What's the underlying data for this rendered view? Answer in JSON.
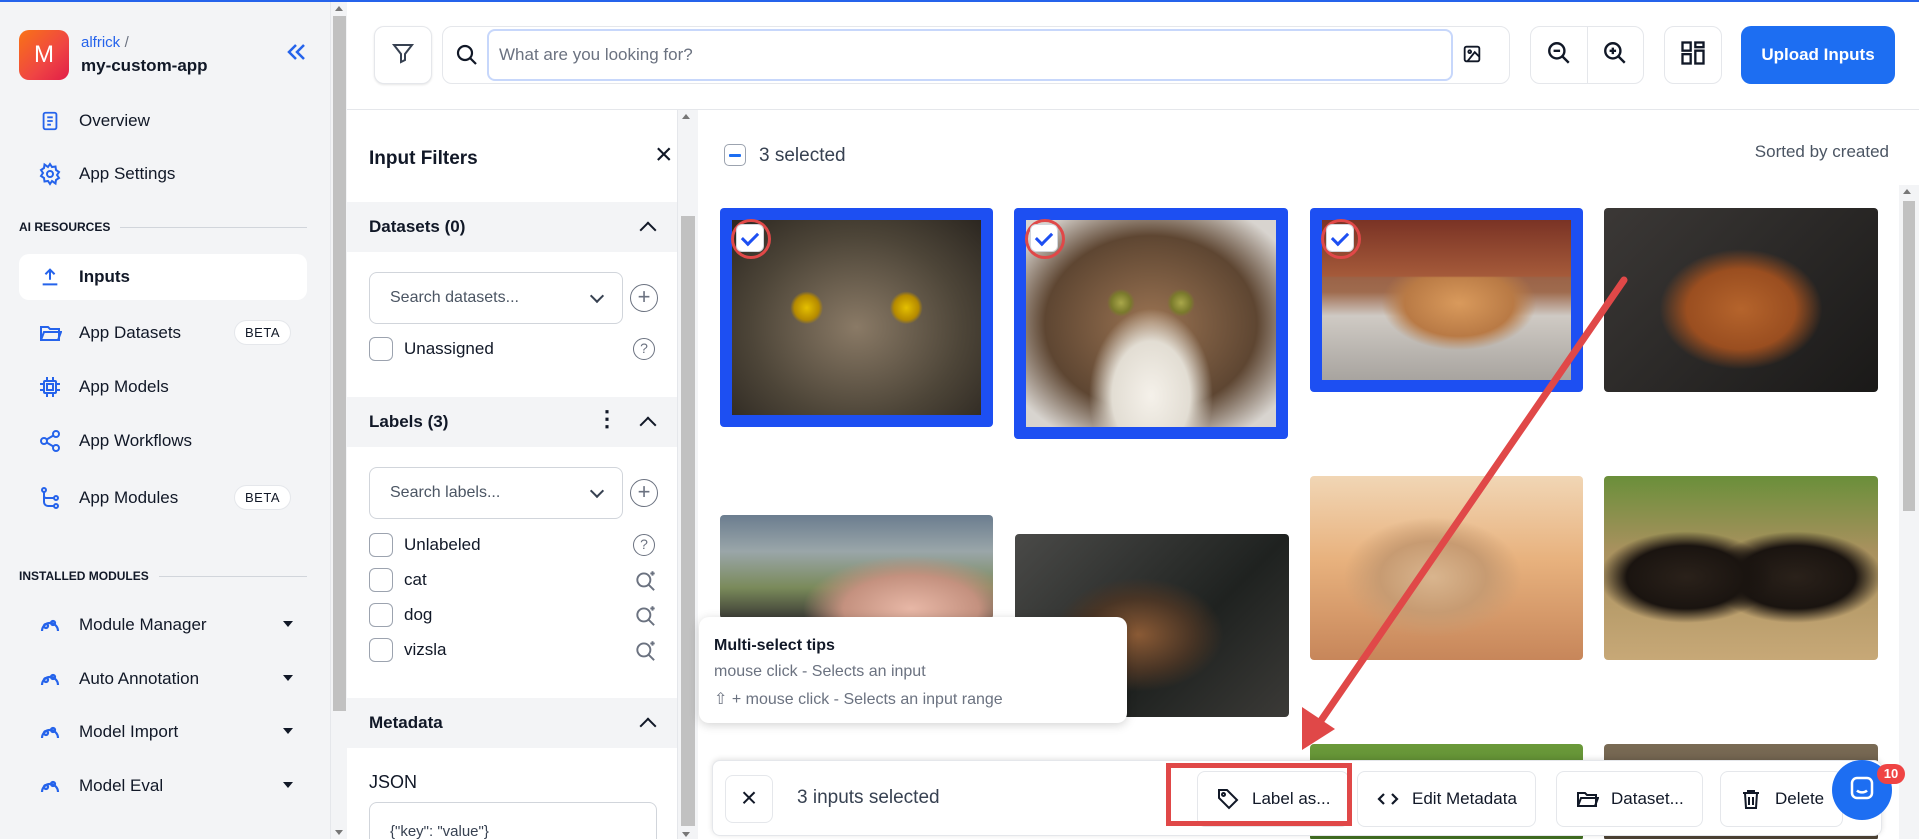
{
  "app": {
    "avatar_letter": "M",
    "org": "alfrick",
    "org_sep": "/",
    "name": "my-custom-app"
  },
  "sidebar": {
    "nav_top": [
      {
        "label": "Overview",
        "icon": "document-icon"
      },
      {
        "label": "App Settings",
        "icon": "gear-icon"
      }
    ],
    "ai_section": "AI RESOURCES",
    "ai_items": [
      {
        "label": "Inputs",
        "icon": "upload-icon",
        "active": true
      },
      {
        "label": "App Datasets",
        "icon": "folder-icon",
        "badge": "BETA"
      },
      {
        "label": "App Models",
        "icon": "chip-icon"
      },
      {
        "label": "App Workflows",
        "icon": "share-icon"
      },
      {
        "label": "App Modules",
        "icon": "flow-icon",
        "badge": "BETA"
      }
    ],
    "installed_section": "INSTALLED MODULES",
    "installed_items": [
      {
        "label": "Module Manager",
        "icon": "module-icon"
      },
      {
        "label": "Auto Annotation",
        "icon": "module-icon"
      },
      {
        "label": "Model Import",
        "icon": "module-icon"
      },
      {
        "label": "Model Eval",
        "icon": "module-icon"
      }
    ]
  },
  "topbar": {
    "search_placeholder": "What are you looking for?",
    "upload_label": "Upload Inputs"
  },
  "filters": {
    "title": "Input Filters",
    "datasets": {
      "header": "Datasets (0)",
      "search_placeholder": "Search datasets...",
      "options": [
        "Unassigned"
      ]
    },
    "labels": {
      "header": "Labels (3)",
      "search_placeholder": "Search labels...",
      "options": [
        "Unlabeled",
        "cat",
        "dog",
        "vizsla"
      ]
    },
    "metadata": {
      "header": "Metadata",
      "json_label": "JSON",
      "json_placeholder": "{\"key\": \"value\"}"
    }
  },
  "content": {
    "selected_count": "3 selected",
    "sorted_by": "Sorted by created",
    "accent_color": "#1d4ff2",
    "tiles": [
      {
        "subject": "cat close-up yellow eyes",
        "selected": true
      },
      {
        "subject": "tabby cat portrait",
        "selected": true
      },
      {
        "subject": "orange kitten sleeping",
        "selected": true
      },
      {
        "subject": "vizsla dog",
        "selected": false
      },
      {
        "subject": "sphynx cat with hand",
        "selected": false
      },
      {
        "subject": "tortoiseshell cat",
        "selected": false
      },
      {
        "subject": "french bulldog lying",
        "selected": false
      },
      {
        "subject": "two rottweiler puppies",
        "selected": false
      }
    ]
  },
  "tips": {
    "title": "Multi-select tips",
    "line1": "mouse click - Selects an input",
    "line2": "⇧ + mouse click - Selects an input range"
  },
  "actionbar": {
    "count": "3 inputs selected",
    "label_as": "Label as...",
    "edit_metadata": "Edit Metadata",
    "dataset": "Dataset...",
    "delete": "Delete"
  },
  "chat": {
    "badge": "10"
  },
  "annotation_color": "#e04848"
}
